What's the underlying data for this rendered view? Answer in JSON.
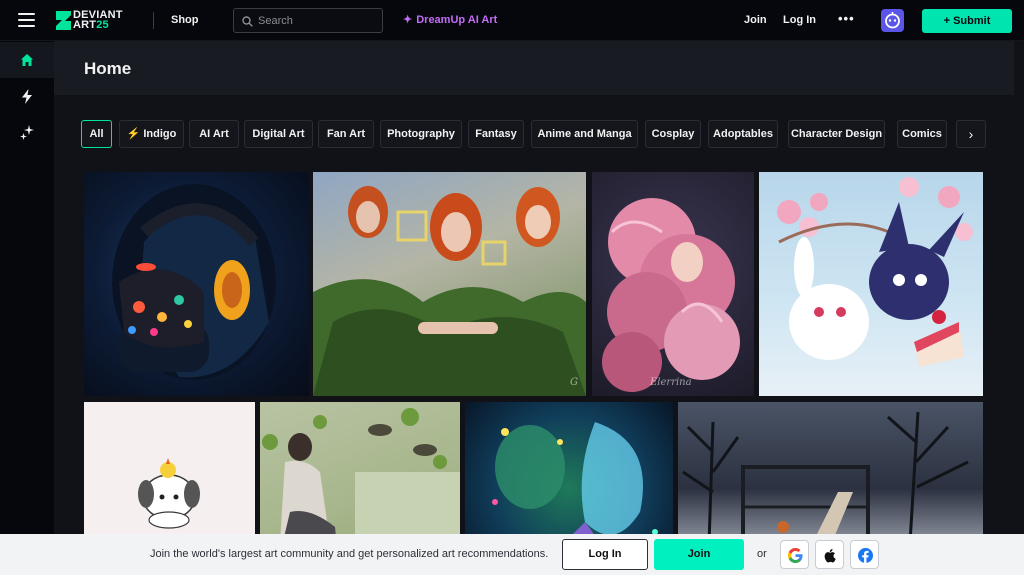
{
  "header": {
    "logo_line1": "DEVIANT",
    "logo_line2": "ART",
    "logo_badge": "25",
    "shop_label": "Shop",
    "search_placeholder": "Search",
    "dreamup_label": "DreamUp AI Art",
    "join_label": "Join",
    "login_label": "Log In",
    "more_label": "•••",
    "submit_label": "+ Submit",
    "brand_color": "#00e59b",
    "submit_color": "#00e5b0"
  },
  "sidebar": {
    "items": [
      {
        "name": "home",
        "icon": "home-icon",
        "active": true
      },
      {
        "name": "indigo",
        "icon": "bolt-icon",
        "active": false
      },
      {
        "name": "dreamup",
        "icon": "sparkle-icon",
        "active": false
      }
    ]
  },
  "page": {
    "title": "Home"
  },
  "filters": {
    "chips": [
      "All",
      "Indigo",
      "AI Art",
      "Digital Art",
      "Fan Art",
      "Photography",
      "Fantasy",
      "Anime and Manga",
      "Cosplay",
      "Adoptables",
      "Character Design",
      "Comics"
    ],
    "active": "All",
    "next_arrow": "›"
  },
  "gallery": {
    "tiles": [
      {
        "subject": "masked-woman-headphones"
      },
      {
        "subject": "three-redheads-foliage"
      },
      {
        "subject": "pink-haired-girl",
        "caption": "Elerrina"
      },
      {
        "subject": "chibi-creatures-cake"
      },
      {
        "subject": "cute-white-puppy-chick"
      },
      {
        "subject": "woman-with-ducks"
      },
      {
        "subject": "colorful-fairy-wing"
      },
      {
        "subject": "winter-playground"
      }
    ]
  },
  "banner": {
    "text": "Join the world's largest art community and get personalized art recommendations.",
    "login_label": "Log In",
    "join_label": "Join",
    "or_label": "or",
    "social": [
      "google-icon",
      "apple-icon",
      "facebook-icon"
    ]
  }
}
